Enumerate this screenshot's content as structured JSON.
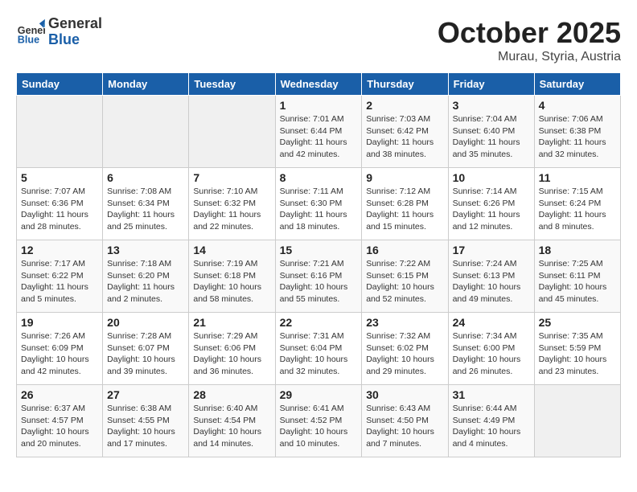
{
  "header": {
    "logo_line1": "General",
    "logo_line2": "Blue",
    "month_year": "October 2025",
    "location": "Murau, Styria, Austria"
  },
  "weekdays": [
    "Sunday",
    "Monday",
    "Tuesday",
    "Wednesday",
    "Thursday",
    "Friday",
    "Saturday"
  ],
  "weeks": [
    [
      {
        "day": "",
        "info": ""
      },
      {
        "day": "",
        "info": ""
      },
      {
        "day": "",
        "info": ""
      },
      {
        "day": "1",
        "info": "Sunrise: 7:01 AM\nSunset: 6:44 PM\nDaylight: 11 hours\nand 42 minutes."
      },
      {
        "day": "2",
        "info": "Sunrise: 7:03 AM\nSunset: 6:42 PM\nDaylight: 11 hours\nand 38 minutes."
      },
      {
        "day": "3",
        "info": "Sunrise: 7:04 AM\nSunset: 6:40 PM\nDaylight: 11 hours\nand 35 minutes."
      },
      {
        "day": "4",
        "info": "Sunrise: 7:06 AM\nSunset: 6:38 PM\nDaylight: 11 hours\nand 32 minutes."
      }
    ],
    [
      {
        "day": "5",
        "info": "Sunrise: 7:07 AM\nSunset: 6:36 PM\nDaylight: 11 hours\nand 28 minutes."
      },
      {
        "day": "6",
        "info": "Sunrise: 7:08 AM\nSunset: 6:34 PM\nDaylight: 11 hours\nand 25 minutes."
      },
      {
        "day": "7",
        "info": "Sunrise: 7:10 AM\nSunset: 6:32 PM\nDaylight: 11 hours\nand 22 minutes."
      },
      {
        "day": "8",
        "info": "Sunrise: 7:11 AM\nSunset: 6:30 PM\nDaylight: 11 hours\nand 18 minutes."
      },
      {
        "day": "9",
        "info": "Sunrise: 7:12 AM\nSunset: 6:28 PM\nDaylight: 11 hours\nand 15 minutes."
      },
      {
        "day": "10",
        "info": "Sunrise: 7:14 AM\nSunset: 6:26 PM\nDaylight: 11 hours\nand 12 minutes."
      },
      {
        "day": "11",
        "info": "Sunrise: 7:15 AM\nSunset: 6:24 PM\nDaylight: 11 hours\nand 8 minutes."
      }
    ],
    [
      {
        "day": "12",
        "info": "Sunrise: 7:17 AM\nSunset: 6:22 PM\nDaylight: 11 hours\nand 5 minutes."
      },
      {
        "day": "13",
        "info": "Sunrise: 7:18 AM\nSunset: 6:20 PM\nDaylight: 11 hours\nand 2 minutes."
      },
      {
        "day": "14",
        "info": "Sunrise: 7:19 AM\nSunset: 6:18 PM\nDaylight: 10 hours\nand 58 minutes."
      },
      {
        "day": "15",
        "info": "Sunrise: 7:21 AM\nSunset: 6:16 PM\nDaylight: 10 hours\nand 55 minutes."
      },
      {
        "day": "16",
        "info": "Sunrise: 7:22 AM\nSunset: 6:15 PM\nDaylight: 10 hours\nand 52 minutes."
      },
      {
        "day": "17",
        "info": "Sunrise: 7:24 AM\nSunset: 6:13 PM\nDaylight: 10 hours\nand 49 minutes."
      },
      {
        "day": "18",
        "info": "Sunrise: 7:25 AM\nSunset: 6:11 PM\nDaylight: 10 hours\nand 45 minutes."
      }
    ],
    [
      {
        "day": "19",
        "info": "Sunrise: 7:26 AM\nSunset: 6:09 PM\nDaylight: 10 hours\nand 42 minutes."
      },
      {
        "day": "20",
        "info": "Sunrise: 7:28 AM\nSunset: 6:07 PM\nDaylight: 10 hours\nand 39 minutes."
      },
      {
        "day": "21",
        "info": "Sunrise: 7:29 AM\nSunset: 6:06 PM\nDaylight: 10 hours\nand 36 minutes."
      },
      {
        "day": "22",
        "info": "Sunrise: 7:31 AM\nSunset: 6:04 PM\nDaylight: 10 hours\nand 32 minutes."
      },
      {
        "day": "23",
        "info": "Sunrise: 7:32 AM\nSunset: 6:02 PM\nDaylight: 10 hours\nand 29 minutes."
      },
      {
        "day": "24",
        "info": "Sunrise: 7:34 AM\nSunset: 6:00 PM\nDaylight: 10 hours\nand 26 minutes."
      },
      {
        "day": "25",
        "info": "Sunrise: 7:35 AM\nSunset: 5:59 PM\nDaylight: 10 hours\nand 23 minutes."
      }
    ],
    [
      {
        "day": "26",
        "info": "Sunrise: 6:37 AM\nSunset: 4:57 PM\nDaylight: 10 hours\nand 20 minutes."
      },
      {
        "day": "27",
        "info": "Sunrise: 6:38 AM\nSunset: 4:55 PM\nDaylight: 10 hours\nand 17 minutes."
      },
      {
        "day": "28",
        "info": "Sunrise: 6:40 AM\nSunset: 4:54 PM\nDaylight: 10 hours\nand 14 minutes."
      },
      {
        "day": "29",
        "info": "Sunrise: 6:41 AM\nSunset: 4:52 PM\nDaylight: 10 hours\nand 10 minutes."
      },
      {
        "day": "30",
        "info": "Sunrise: 6:43 AM\nSunset: 4:50 PM\nDaylight: 10 hours\nand 7 minutes."
      },
      {
        "day": "31",
        "info": "Sunrise: 6:44 AM\nSunset: 4:49 PM\nDaylight: 10 hours\nand 4 minutes."
      },
      {
        "day": "",
        "info": ""
      }
    ]
  ]
}
